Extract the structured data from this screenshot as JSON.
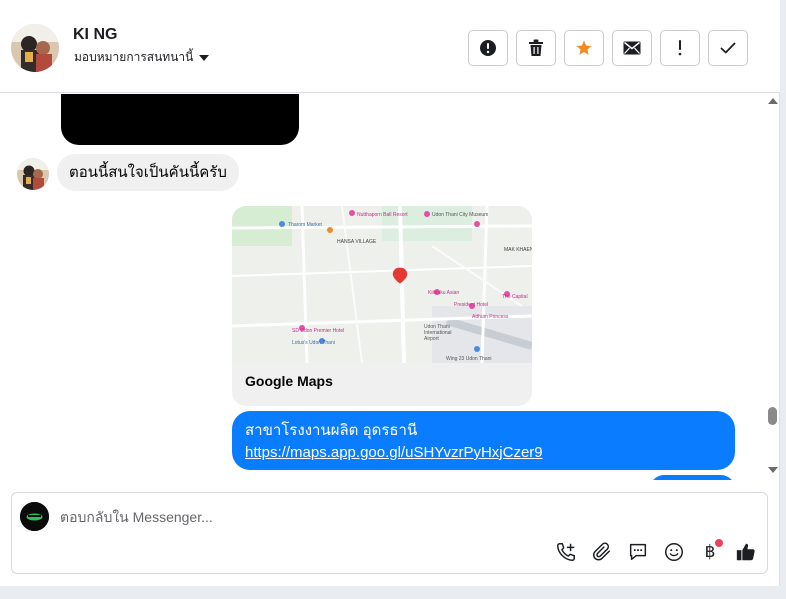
{
  "header": {
    "contact_name": "KI NG",
    "assign_label": "มอบหมายการสนทนานี้",
    "actions": [
      {
        "icon": "alert-circle-icon",
        "name": "mark-spam-button"
      },
      {
        "icon": "trash-icon",
        "name": "delete-button"
      },
      {
        "icon": "star-icon",
        "name": "star-button",
        "color": "#f28c1e"
      },
      {
        "icon": "envelope-icon",
        "name": "mark-unread-button"
      },
      {
        "icon": "exclamation-icon",
        "name": "follow-up-button"
      },
      {
        "icon": "check-icon",
        "name": "mark-done-button"
      }
    ]
  },
  "messages": {
    "incoming_text": "ตอนนี้สนใจเป็นคันนี้ครับ",
    "map_card": {
      "caption": "Google Maps",
      "map_labels": [
        "Nutthaporn Ball Resort",
        "Udon Thani City Museum",
        "Thung Si Muang",
        "Tharom Market",
        "HANSA VILLAGE",
        "MAK KHAENG",
        "Kiilauku Asian Udon Thani",
        "The Capital Hotel",
        "President Hotel",
        "Atthum Princess Hotel",
        "Udon Thani International Airport",
        "Lotus's Udon Thani",
        "SD Udon Premier Hotel",
        "Wing 23 Udon Thani"
      ]
    },
    "outgoing_title": "สาขาโรงงานผลิต อุดรธานี",
    "outgoing_link": "https://maps.app.goo.gl/uSHYvzrPyHxjCzer9"
  },
  "composer": {
    "placeholder": "ตอบกลับใน Messenger...",
    "tools": [
      {
        "icon": "add-call-icon"
      },
      {
        "icon": "paperclip-icon"
      },
      {
        "icon": "chat-template-icon"
      },
      {
        "icon": "emoji-icon"
      },
      {
        "icon": "baht-payment-icon",
        "glyph": "฿"
      },
      {
        "icon": "thumbs-up-icon"
      }
    ]
  },
  "colors": {
    "brand_blue": "#0a7cff",
    "star_orange": "#f28c1e",
    "notification_red": "#e8435a"
  }
}
